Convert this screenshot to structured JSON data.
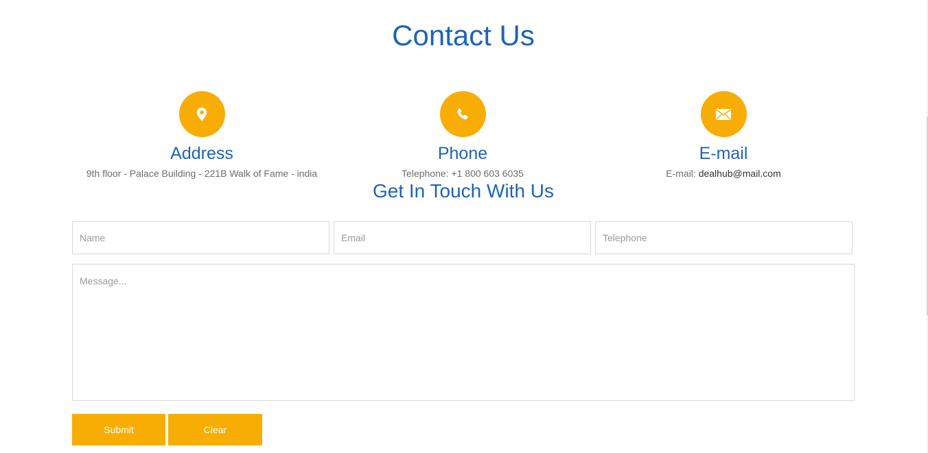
{
  "page": {
    "title": "Contact Us",
    "accent_color": "#f8ad05",
    "heading_color": "#1e63b5"
  },
  "info": {
    "address": {
      "icon": "map-marker-icon",
      "heading": "Address",
      "text": "9th floor - Palace Building - 221B Walk of Fame - india"
    },
    "phone": {
      "icon": "phone-icon",
      "heading": "Phone",
      "text": "Telephone: +1 800 603 6035"
    },
    "email": {
      "icon": "envelope-icon",
      "heading": "E-mail",
      "label": "E-mail: ",
      "value": "dealhub@mail.com"
    }
  },
  "form": {
    "title": "Get In Touch With Us",
    "name_placeholder": "Name",
    "email_placeholder": "Email",
    "telephone_placeholder": "Telephone",
    "message_placeholder": "Message...",
    "submit_label": "Submit",
    "clear_label": "Clear"
  }
}
